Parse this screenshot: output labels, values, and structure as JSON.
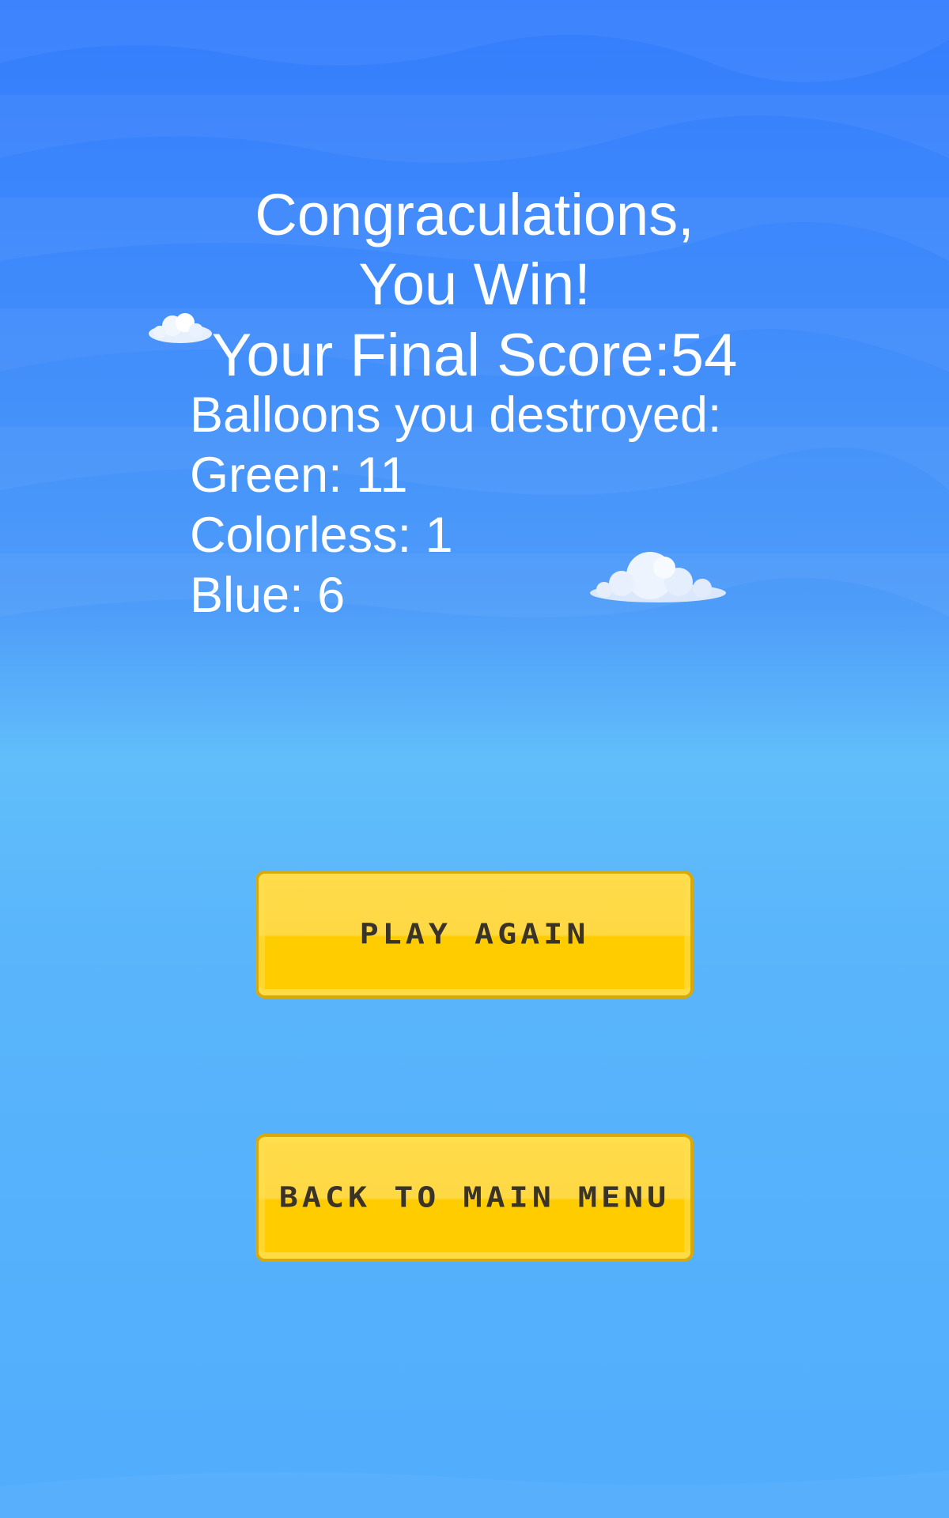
{
  "title": {
    "line1": "Congraculations,",
    "line2": "You Win!"
  },
  "score": {
    "label": "Your Final Score:54"
  },
  "stats": {
    "header": "Balloons you destroyed:",
    "green": "Green: 11",
    "colorless": "Colorless: 1",
    "blue": "Blue: 6"
  },
  "buttons": {
    "play_again": "PLAY AGAIN",
    "main_menu": "BACK TO MAIN MENU"
  },
  "colors": {
    "sky_top": "#347dfd",
    "sky_horizon": "#61befa",
    "button_fill": "#ffcc00",
    "button_border": "#d8a90b",
    "button_text": "#3a3328",
    "text": "#ffffff"
  },
  "icons": [
    "cloud-small-icon",
    "cloud-large-icon"
  ]
}
